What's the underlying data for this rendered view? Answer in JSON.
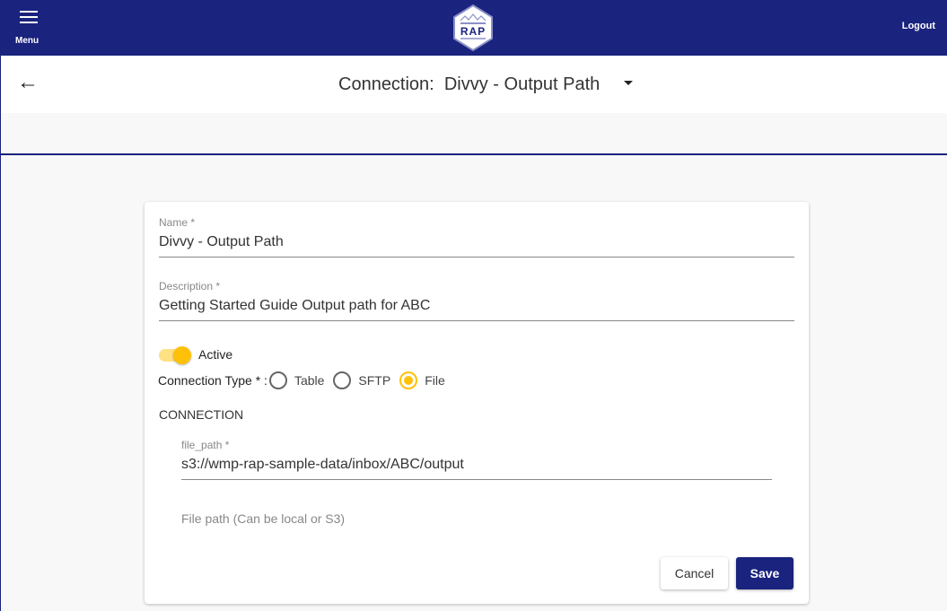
{
  "header": {
    "menu_label": "Menu",
    "logo_text": "RAP",
    "logout_label": "Logout"
  },
  "subheader": {
    "title": "Connection:  Divvy - Output Path"
  },
  "form": {
    "name": {
      "label": "Name *",
      "value": "Divvy - Output Path"
    },
    "description": {
      "label": "Description *",
      "value": "Getting Started Guide Output path for ABC"
    },
    "active": {
      "label": "Active",
      "on": true
    },
    "connection_type": {
      "label": "Connection Type * :",
      "options": [
        "Table",
        "SFTP",
        "File"
      ],
      "selected": "File"
    },
    "section_title": "CONNECTION",
    "file_path": {
      "label": "file_path *",
      "value": "s3://wmp-rap-sample-data/inbox/ABC/output",
      "help": "File path (Can be local or S3)"
    },
    "cancel_label": "Cancel",
    "save_label": "Save"
  },
  "colors": {
    "primary": "#1a237e",
    "accent": "#ffc107"
  }
}
